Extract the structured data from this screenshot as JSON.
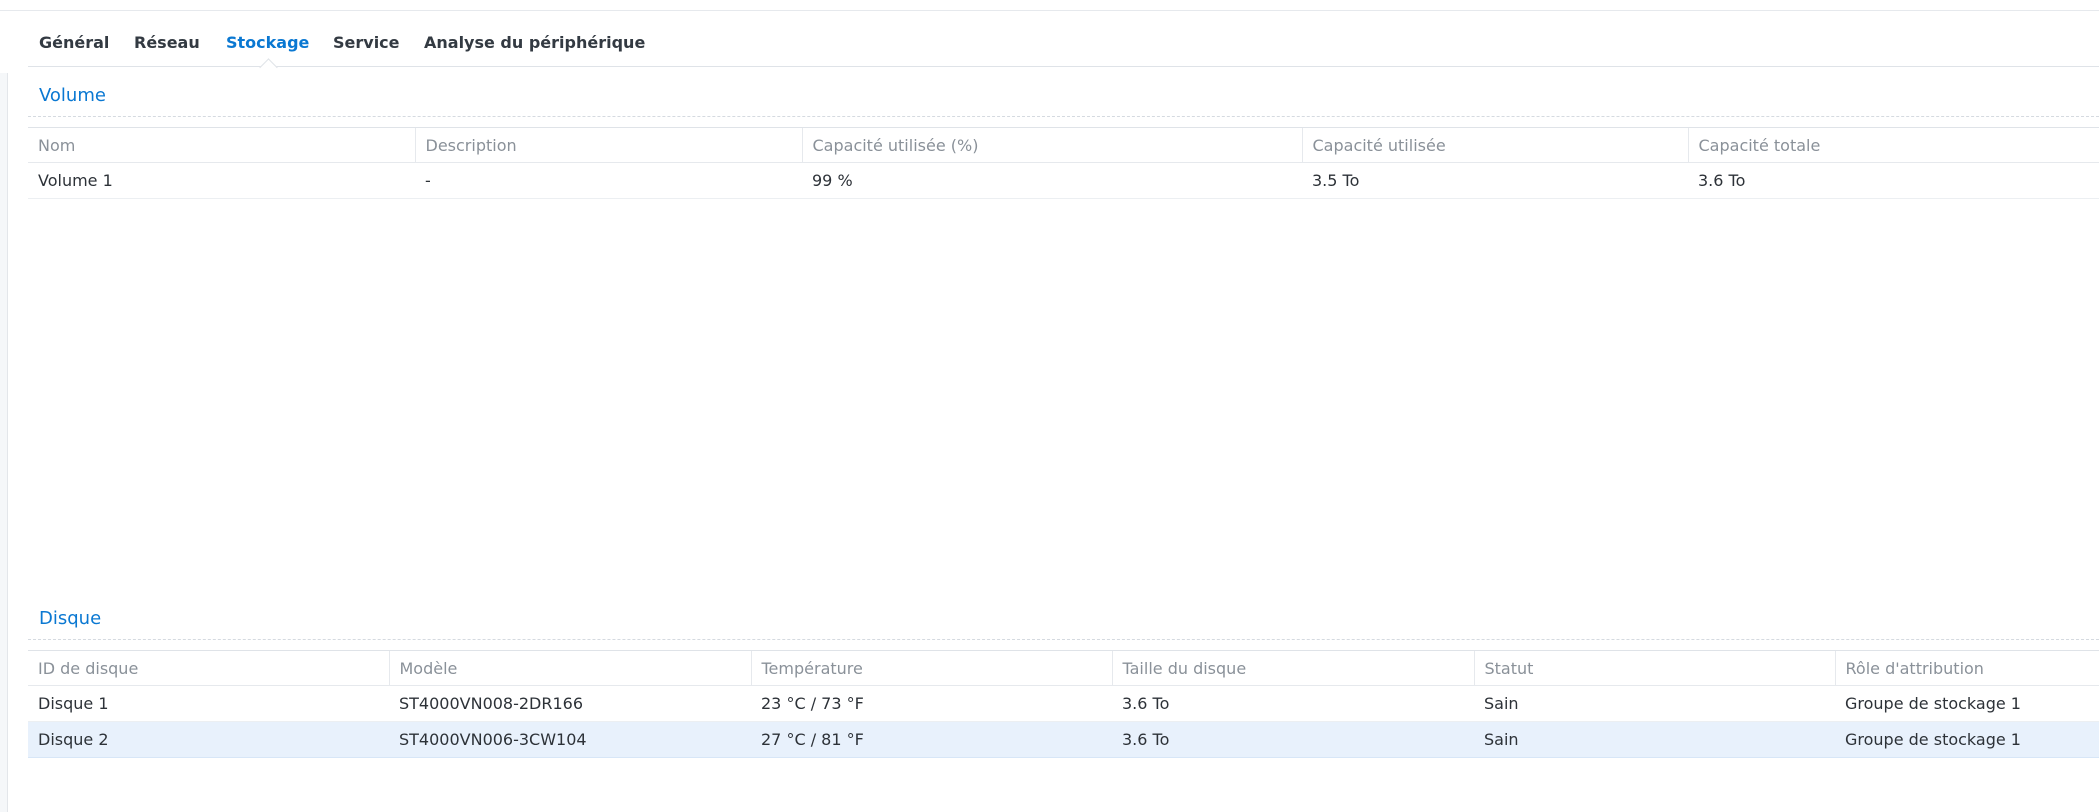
{
  "tabs": [
    {
      "label": "Général"
    },
    {
      "label": "Réseau"
    },
    {
      "label": "Stockage"
    },
    {
      "label": "Service"
    },
    {
      "label": "Analyse du périphérique"
    }
  ],
  "active_tab": "Stockage",
  "volume_section": {
    "title": "Volume",
    "columns": [
      "Nom",
      "Description",
      "Capacité utilisée (%)",
      "Capacité utilisée",
      "Capacité totale"
    ],
    "rows": [
      {
        "name": "Volume 1",
        "description": "-",
        "used_percent": "99 %",
        "used": "3.5 To",
        "total": "3.6 To"
      }
    ]
  },
  "disk_section": {
    "title": "Disque",
    "columns": [
      "ID de disque",
      "Modèle",
      "Température",
      "Taille du disque",
      "Statut",
      "Rôle d'attribution"
    ],
    "rows": [
      {
        "id": "Disque 1",
        "model": "ST4000VN008-2DR166",
        "temperature": "23 °C / 73 °F",
        "size": "3.6 To",
        "status": "Sain",
        "role": "Groupe de stockage 1"
      },
      {
        "id": "Disque 2",
        "model": "ST4000VN006-3CW104",
        "temperature": "27 °C / 81 °F",
        "size": "3.6 To",
        "status": "Sain",
        "role": "Groupe de stockage 1"
      }
    ],
    "selected_row": 2
  },
  "colors": {
    "accent": "#0a78d2",
    "status_ok": "#3c9a1f",
    "selected_row_bg": "#e8f1fc"
  }
}
